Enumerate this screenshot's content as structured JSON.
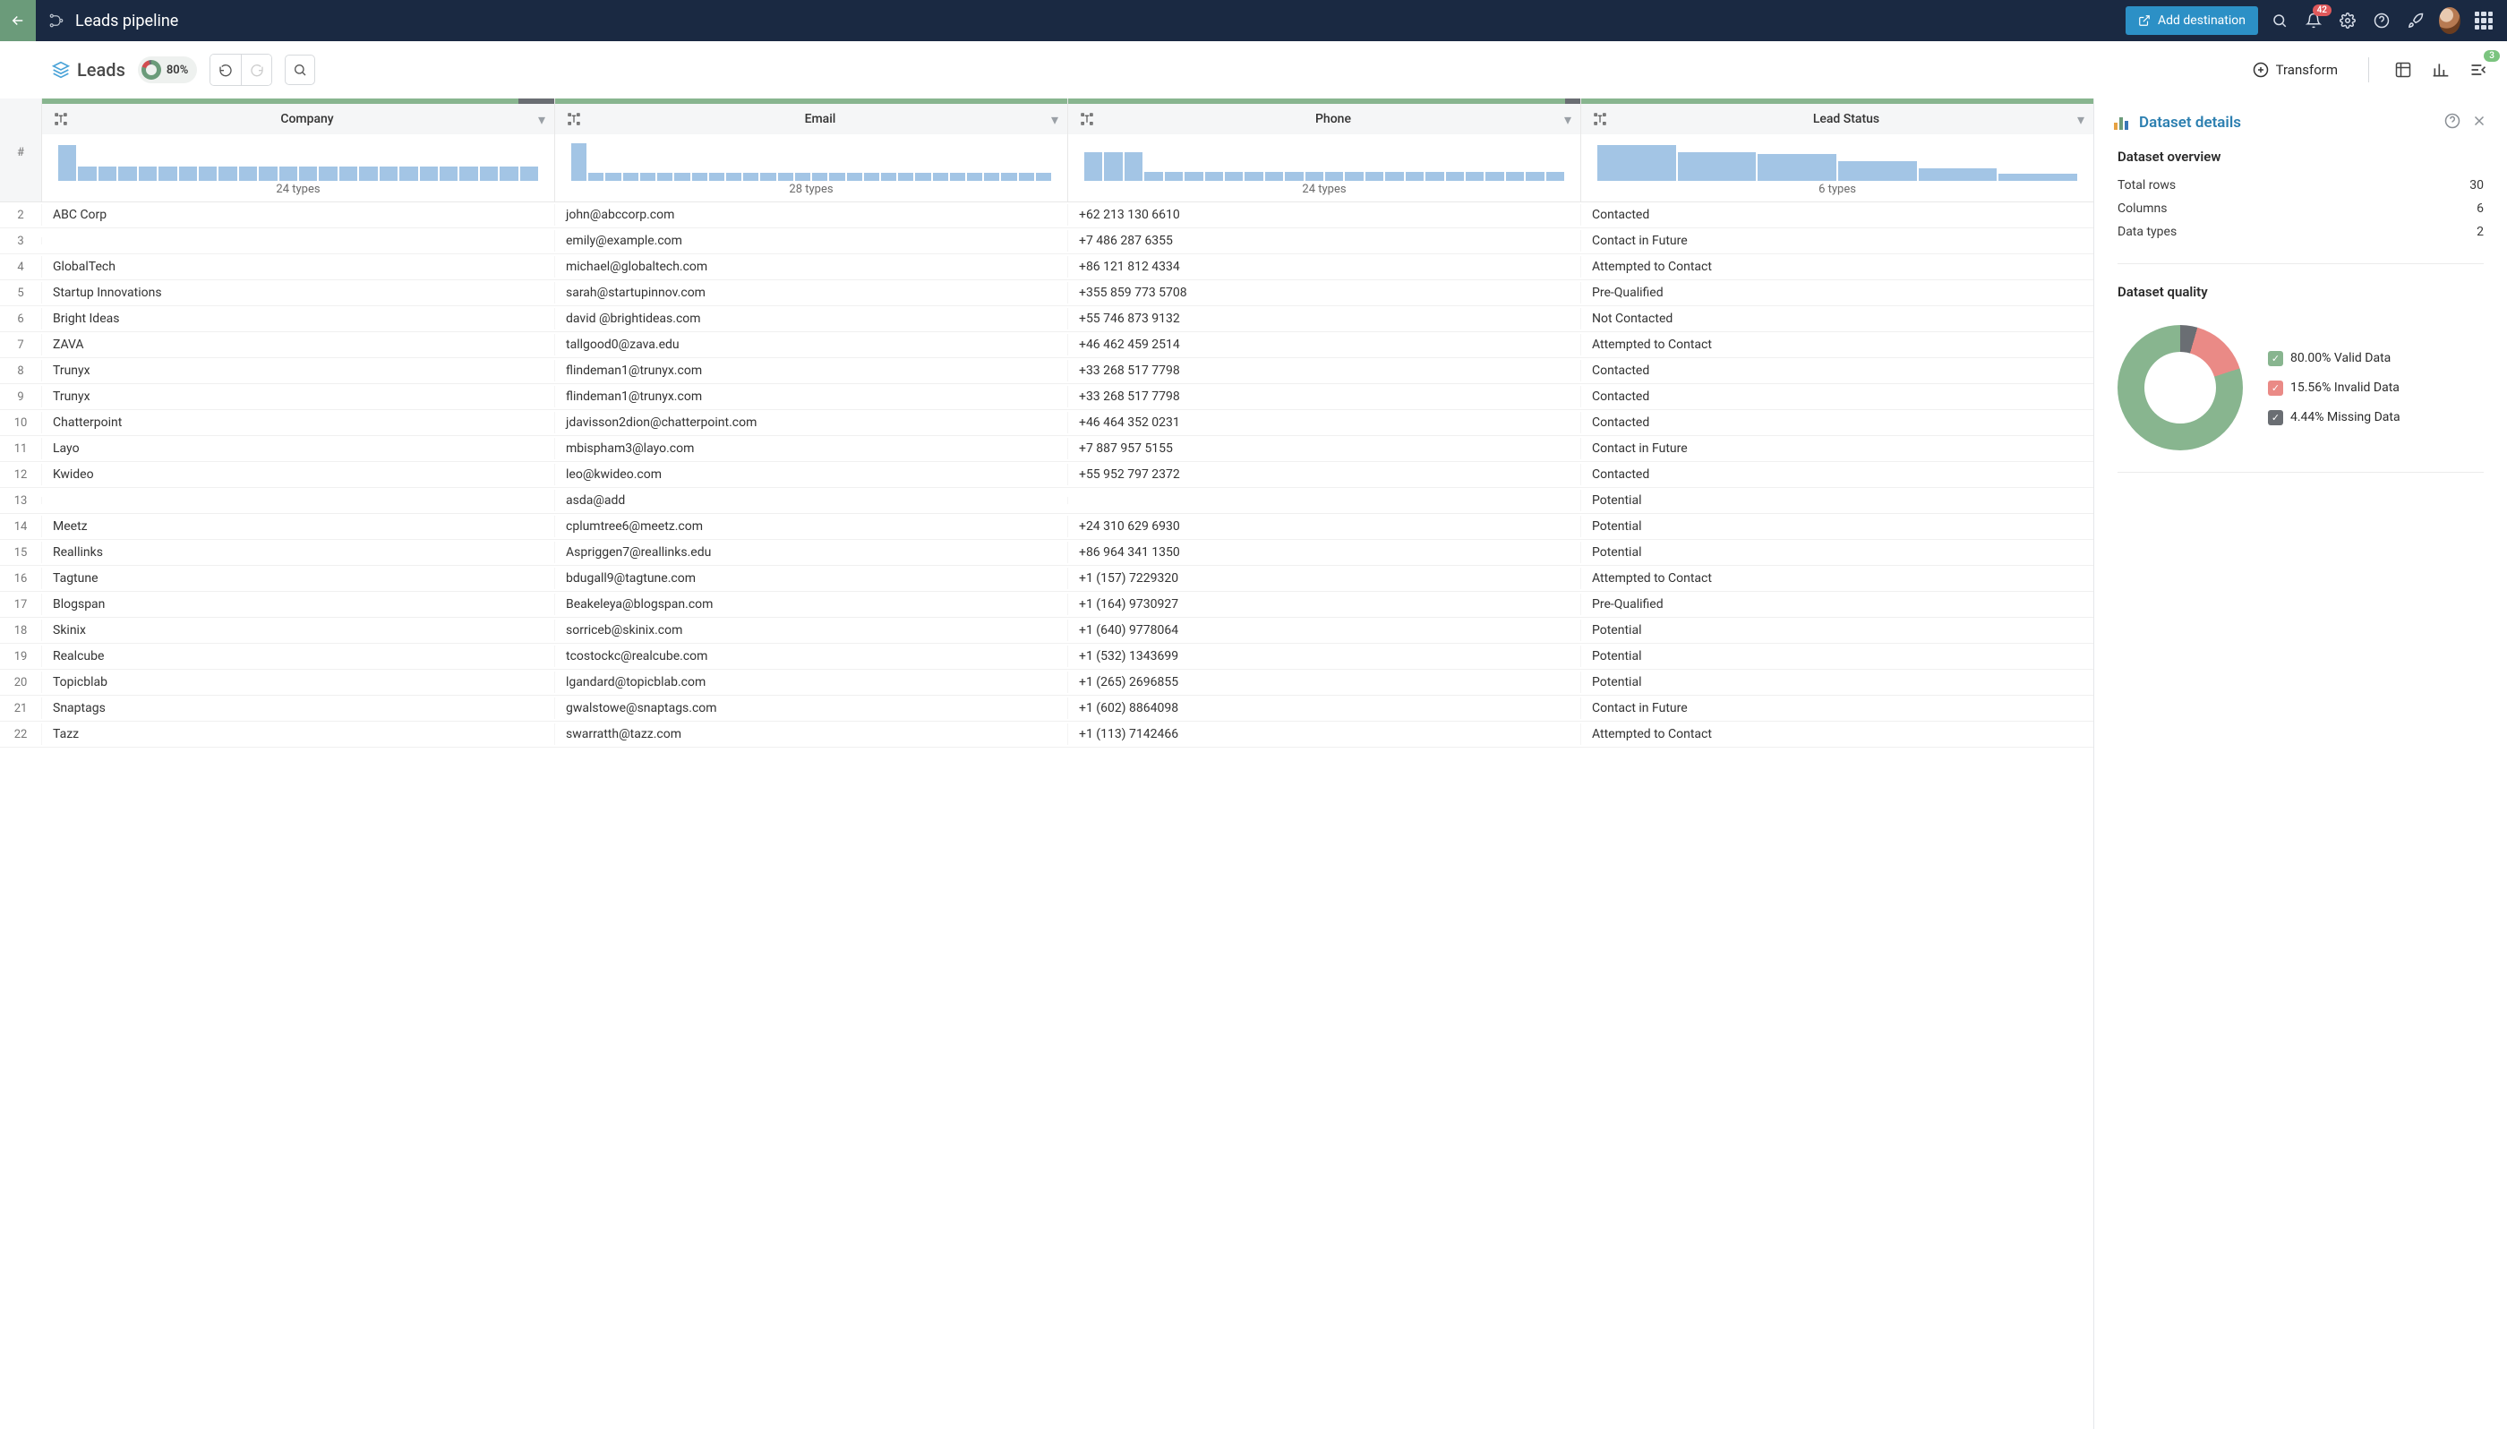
{
  "header": {
    "title": "Leads pipeline",
    "add_destination": "Add destination",
    "notif_count": "42"
  },
  "toolbar": {
    "tab": "Leads",
    "pct": "80%",
    "transform": "Transform",
    "panel_badge": "3"
  },
  "columns": [
    {
      "name": "Company",
      "types": "24 types",
      "hist": [
        40,
        16,
        16,
        16,
        16,
        16,
        16,
        16,
        16,
        16,
        16,
        16,
        16,
        16,
        16,
        16,
        16,
        16,
        16,
        16,
        16,
        16,
        16,
        16
      ],
      "quality": {
        "g": 93,
        "r": 0,
        "d": 7
      }
    },
    {
      "name": "Email",
      "types": "28 types",
      "hist": [
        42,
        9,
        9,
        9,
        9,
        9,
        9,
        9,
        9,
        9,
        9,
        9,
        9,
        9,
        9,
        9,
        9,
        9,
        9,
        9,
        9,
        9,
        9,
        9,
        9,
        9,
        9,
        9
      ],
      "quality": {
        "g": 100,
        "r": 0,
        "d": 0
      }
    },
    {
      "name": "Phone",
      "types": "24 types",
      "hist": [
        32,
        32,
        32,
        10,
        10,
        10,
        10,
        10,
        10,
        10,
        10,
        10,
        10,
        10,
        10,
        10,
        10,
        10,
        10,
        10,
        10,
        10,
        10,
        10
      ],
      "quality": {
        "g": 97,
        "r": 0,
        "d": 3
      }
    },
    {
      "name": "Lead Status",
      "types": "6 types",
      "hist": [
        40,
        32,
        30,
        22,
        14,
        8
      ],
      "quality": {
        "g": 100,
        "r": 0,
        "d": 0
      }
    }
  ],
  "rows": [
    {
      "n": 2,
      "company": "ABC Corp",
      "email": "john@abccorp.com",
      "phone": "+62 213 130 6610",
      "status": "Contacted"
    },
    {
      "n": 3,
      "company": "",
      "email": "emily@example.com",
      "phone": "+7 486 287 6355",
      "status": "Contact in Future"
    },
    {
      "n": 4,
      "company": "GlobalTech",
      "email": "michael@globaltech.com",
      "phone": "+86 121 812 4334",
      "status": "Attempted to Contact"
    },
    {
      "n": 5,
      "company": "Startup Innovations",
      "email": "sarah@startupinnov.com",
      "phone": "+355 859 773 5708",
      "status": "Pre-Qualified"
    },
    {
      "n": 6,
      "company": "Bright Ideas",
      "email": "david @brightideas.com",
      "phone": "+55 746 873 9132",
      "status": "Not Contacted"
    },
    {
      "n": 7,
      "company": "ZAVA",
      "email": "tallgood0@zava.edu",
      "phone": "+46 462 459 2514",
      "status": "Attempted to Contact"
    },
    {
      "n": 8,
      "company": "Trunyx",
      "email": "flindeman1@trunyx.com",
      "phone": "+33 268 517 7798",
      "status": "Contacted"
    },
    {
      "n": 9,
      "company": "Trunyx",
      "email": "flindeman1@trunyx.com",
      "phone": "+33 268 517 7798",
      "status": "Contacted"
    },
    {
      "n": 10,
      "company": "Chatterpoint",
      "email": "jdavisson2dion@chatterpoint.com",
      "phone": "+46 464 352 0231",
      "status": "Contacted"
    },
    {
      "n": 11,
      "company": "Layo",
      "email": "mbispham3@layo.com",
      "phone": "+7 887 957 5155",
      "status": "Contact in Future"
    },
    {
      "n": 12,
      "company": "Kwideo",
      "email": "leo@kwideo.com",
      "phone": "+55 952 797 2372",
      "status": "Contacted"
    },
    {
      "n": 13,
      "company": "",
      "email": "asda@add",
      "phone": "",
      "status": "Potential"
    },
    {
      "n": 14,
      "company": "Meetz",
      "email": "cplumtree6@meetz.com",
      "phone": "+24 310 629 6930",
      "status": "Potential"
    },
    {
      "n": 15,
      "company": "Reallinks",
      "email": "Aspriggen7@reallinks.edu",
      "phone": "+86 964 341 1350",
      "status": "Potential"
    },
    {
      "n": 16,
      "company": "Tagtune",
      "email": "bdugall9@tagtune.com",
      "phone": "+1 (157) 7229320",
      "status": "Attempted to Contact"
    },
    {
      "n": 17,
      "company": "Blogspan",
      "email": "Beakeleya@blogspan.com",
      "phone": "+1 (164) 9730927",
      "status": "Pre-Qualified"
    },
    {
      "n": 18,
      "company": "Skinix",
      "email": "sorriceb@skinix.com",
      "phone": "+1 (640) 9778064",
      "status": "Potential"
    },
    {
      "n": 19,
      "company": "Realcube",
      "email": "tcostockc@realcube.com",
      "phone": "+1 (532) 1343699",
      "status": "Potential"
    },
    {
      "n": 20,
      "company": "Topicblab",
      "email": "lgandard@topicblab.com",
      "phone": "+1 (265) 2696855",
      "status": "Potential"
    },
    {
      "n": 21,
      "company": "Snaptags",
      "email": "gwalstowe@snaptags.com",
      "phone": "+1 (602) 8864098",
      "status": "Contact in Future"
    },
    {
      "n": 22,
      "company": "Tazz",
      "email": "swarratth@tazz.com",
      "phone": "+1 (113) 7142466",
      "status": "Attempted to Contact"
    }
  ],
  "panel": {
    "title": "Dataset details",
    "overview_heading": "Dataset overview",
    "rows_label": "Total rows",
    "rows_value": "30",
    "cols_label": "Columns",
    "cols_value": "6",
    "types_label": "Data types",
    "types_value": "2",
    "quality_heading": "Dataset quality",
    "legend": {
      "valid": {
        "label": "80.00% Valid Data",
        "color": "#88b58f",
        "pct": 80.0
      },
      "invalid": {
        "label": "15.56% Invalid Data",
        "color": "#ea8a86",
        "pct": 15.56
      },
      "missing": {
        "label": "4.44% Missing Data",
        "color": "#6a6e73",
        "pct": 4.44
      }
    }
  },
  "chart_data": {
    "type": "pie",
    "title": "Dataset quality",
    "series": [
      {
        "name": "Valid Data",
        "value": 80.0,
        "color": "#88b58f"
      },
      {
        "name": "Invalid Data",
        "value": 15.56,
        "color": "#ea8a86"
      },
      {
        "name": "Missing Data",
        "value": 4.44,
        "color": "#6a6e73"
      }
    ]
  }
}
